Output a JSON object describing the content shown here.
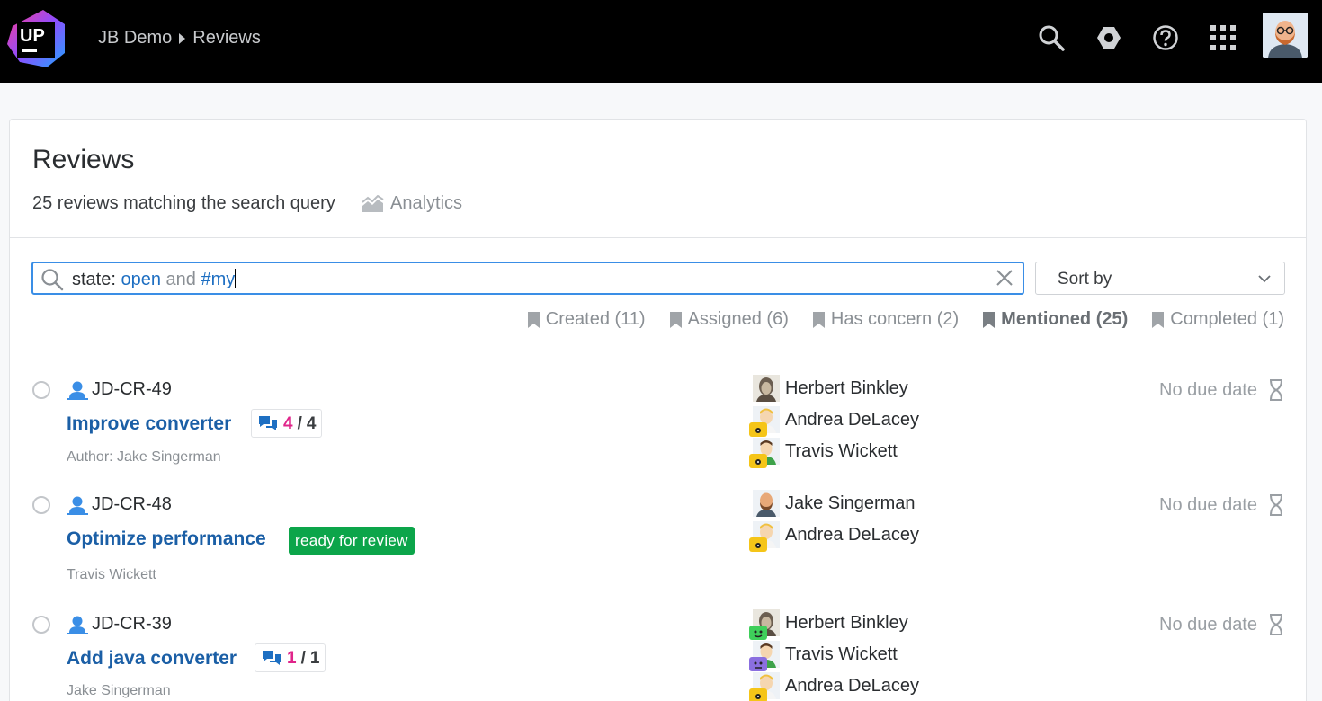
{
  "header": {
    "logo_text": "UP",
    "project": "JB Demo",
    "section": "Reviews"
  },
  "page": {
    "title": "Reviews",
    "summary": "25 reviews matching the search query",
    "analytics_label": "Analytics"
  },
  "search": {
    "query_key": "state: ",
    "query_value": "open",
    "query_op": " and ",
    "query_tag": "#my",
    "sort_label": "Sort by"
  },
  "filters": [
    {
      "label": "Created (11)",
      "active": false
    },
    {
      "label": "Assigned (6)",
      "active": false
    },
    {
      "label": "Has concern (2)",
      "active": false
    },
    {
      "label": "Mentioned (25)",
      "active": true
    },
    {
      "label": "Completed (1)",
      "active": false
    }
  ],
  "reviews": [
    {
      "id": "JD-CR-49",
      "title": "Improve converter",
      "comments_unread": "4",
      "comments_total": "4",
      "meta": "Author: Jake Singerman",
      "due": "No due date",
      "participants": [
        {
          "name": "Herbert Binkley",
          "state": "none"
        },
        {
          "name": "Andrea DeLacey",
          "state": "watching"
        },
        {
          "name": "Travis Wickett",
          "state": "watching"
        }
      ]
    },
    {
      "id": "JD-CR-48",
      "title": "Optimize performance",
      "tag": "ready for review",
      "meta": "Travis Wickett",
      "due": "No due date",
      "participants": [
        {
          "name": "Jake Singerman",
          "state": "none"
        },
        {
          "name": "Andrea DeLacey",
          "state": "watching"
        }
      ]
    },
    {
      "id": "JD-CR-39",
      "title": "Add java converter",
      "comments_unread": "1",
      "comments_total": "1",
      "meta": "Jake Singerman",
      "due": "No due date",
      "participants": [
        {
          "name": "Herbert Binkley",
          "state": "accepted"
        },
        {
          "name": "Travis Wickett",
          "state": "reviewing"
        },
        {
          "name": "Andrea DeLacey",
          "state": "watching"
        }
      ]
    }
  ],
  "colors": {
    "header_bg": "#000000",
    "link": "#1b5fa6",
    "accent_blue": "#3a8ee6",
    "tag_green": "#0ca54a",
    "unread_pink": "#e0248a",
    "watching_yellow": "#f5c518",
    "accepted_green": "#3ecf5a",
    "reviewing_purple": "#8a6fe0"
  },
  "icons": {
    "header": [
      "search-icon",
      "hexagon-settings-icon",
      "help-icon",
      "apps-grid-icon"
    ],
    "row": [
      "user-icon",
      "comments-icon",
      "hourglass-icon",
      "bookmark-icon"
    ]
  }
}
